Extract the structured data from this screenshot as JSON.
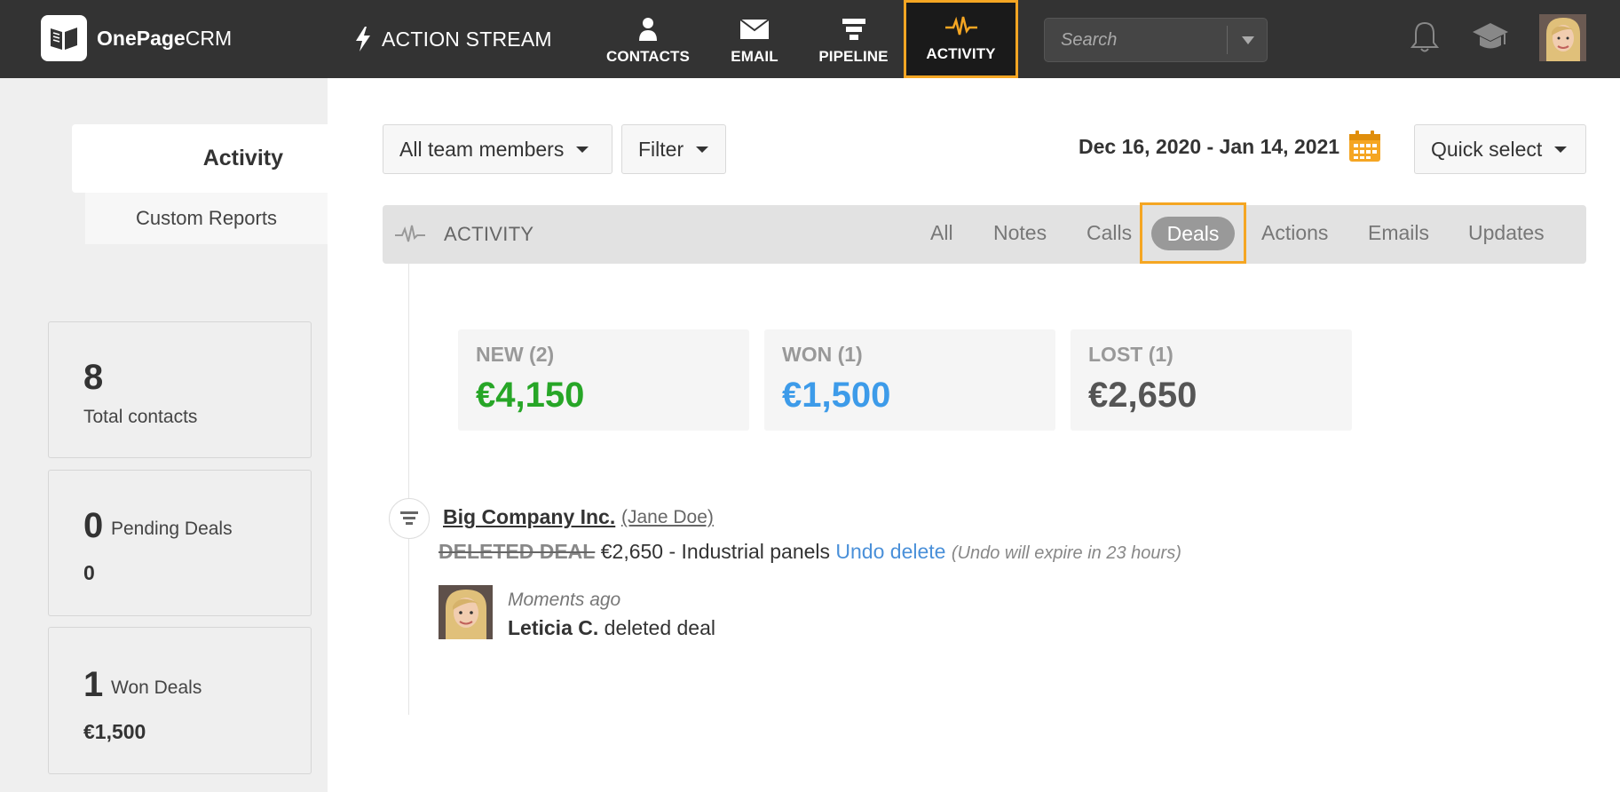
{
  "brand": {
    "name_bold": "OnePage",
    "name_light": "CRM"
  },
  "topnav": {
    "action_stream": "ACTION STREAM",
    "items": [
      {
        "label": "CONTACTS",
        "icon": "person-icon"
      },
      {
        "label": "EMAIL",
        "icon": "envelope-icon"
      },
      {
        "label": "PIPELINE",
        "icon": "pipeline-icon"
      },
      {
        "label": "ACTIVITY",
        "icon": "pulse-icon",
        "active": true
      }
    ],
    "search_placeholder": "Search"
  },
  "sidebar": {
    "tabs": [
      {
        "label": "Activity",
        "active": true
      },
      {
        "label": "Custom Reports"
      }
    ],
    "stats": [
      {
        "value": "8",
        "label": "Total contacts",
        "sub": ""
      },
      {
        "value": "0",
        "label": "Pending Deals",
        "sub": "0"
      },
      {
        "value": "1",
        "label": "Won Deals",
        "sub": "€1,500"
      }
    ]
  },
  "filters": {
    "team": "All team members",
    "filter": "Filter",
    "date_range": "Dec 16, 2020 - Jan 14, 2021",
    "quick_select": "Quick select"
  },
  "activity_bar": {
    "title": "ACTIVITY",
    "tabs": [
      "All",
      "Notes",
      "Calls",
      "Deals",
      "Actions",
      "Emails",
      "Updates"
    ],
    "active_tab": "Deals"
  },
  "summary": [
    {
      "label": "NEW (2)",
      "value": "€4,150",
      "color": "#27a627"
    },
    {
      "label": "WON (1)",
      "value": "€1,500",
      "color": "#3d9be9"
    },
    {
      "label": "LOST (1)",
      "value": "€2,650",
      "color": "#555555"
    }
  ],
  "entry": {
    "company": "Big Company Inc.",
    "contact": "(Jane Doe)",
    "deleted_tag": "DELETED DEAL",
    "details": "€2,650 - Industrial panels",
    "undo": "Undo delete",
    "expire": "(Undo will expire in 23 hours)",
    "time": "Moments ago",
    "user": "Leticia C.",
    "action": "deleted deal"
  }
}
